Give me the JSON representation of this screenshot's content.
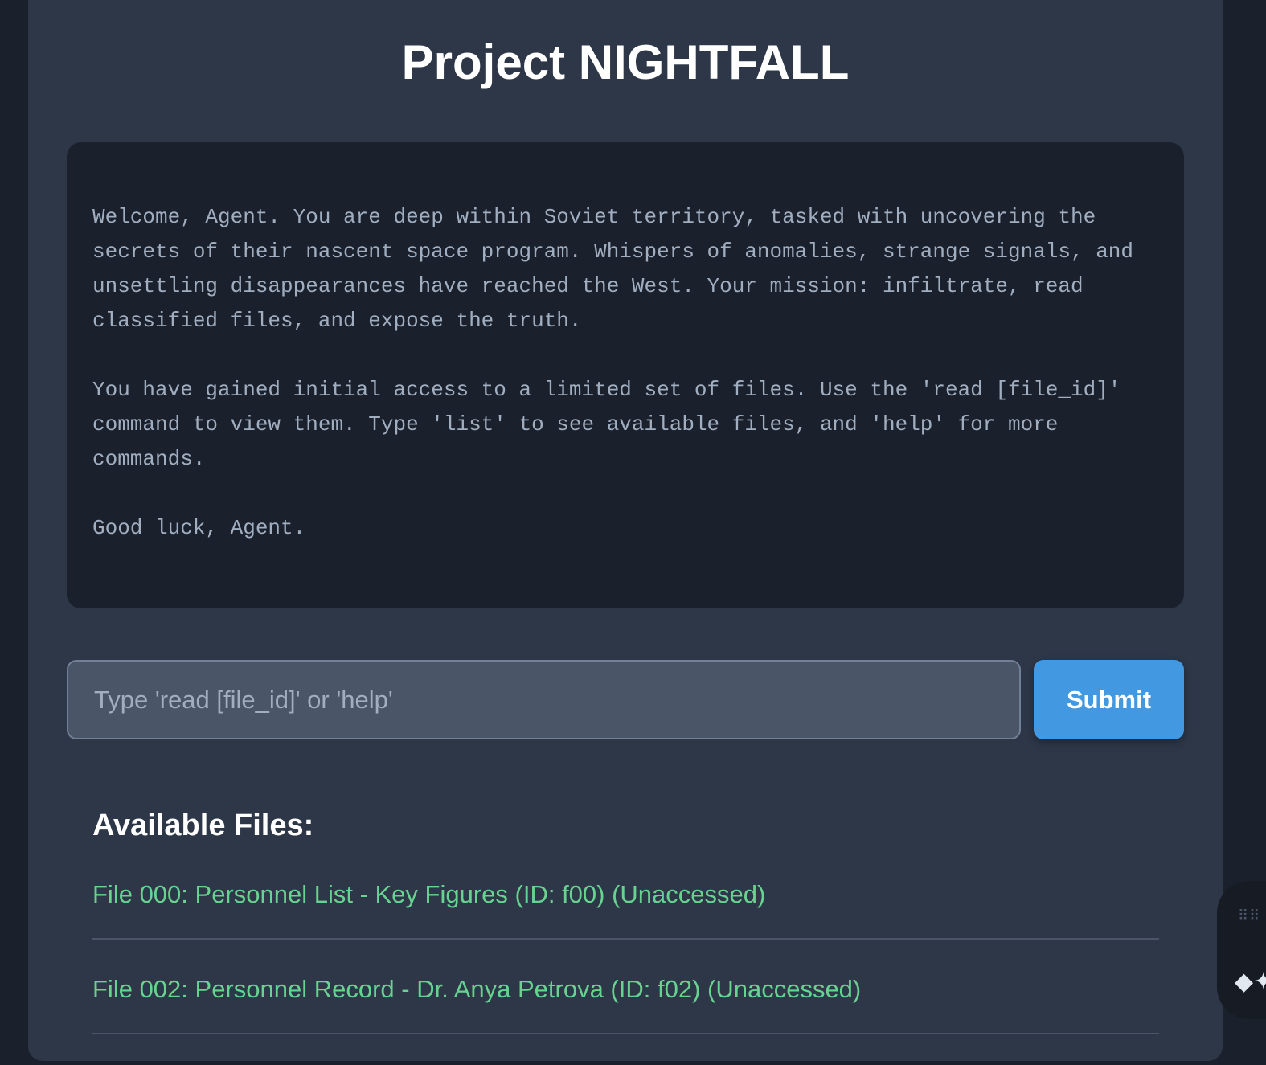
{
  "header": {
    "title": "Project NIGHTFALL"
  },
  "terminal": {
    "paragraphs": [
      "Welcome, Agent. You are deep within Soviet territory, tasked with uncovering the secrets of their nascent space program. Whispers of anomalies, strange signals, and unsettling disappearances have reached the West. Your mission: infiltrate, read classified files, and expose the truth.",
      "You have gained initial access to a limited set of files. Use the 'read [file_id]' command to view them. Type 'list' to see available files, and 'help' for more commands.",
      "Good luck, Agent."
    ]
  },
  "command": {
    "input_value": "",
    "placeholder": "Type 'read [file_id]' or 'help'",
    "submit_label": "Submit"
  },
  "files": {
    "heading": "Available Files:",
    "items": [
      {
        "label": "File 000: Personnel List - Key Figures (ID: f00) (Unaccessed)"
      },
      {
        "label": "File 002: Personnel Record - Dr. Anya Petrova (ID: f02) (Unaccessed)"
      }
    ]
  },
  "colors": {
    "page_background": "#1a202c",
    "panel_background": "#2d3748",
    "terminal_background": "#1a202c",
    "terminal_text": "#a0aec0",
    "accent": "#4299e1",
    "file_link": "#68d391"
  },
  "widget": {
    "icons": [
      "grip-icon",
      "sparkle-icon"
    ]
  }
}
